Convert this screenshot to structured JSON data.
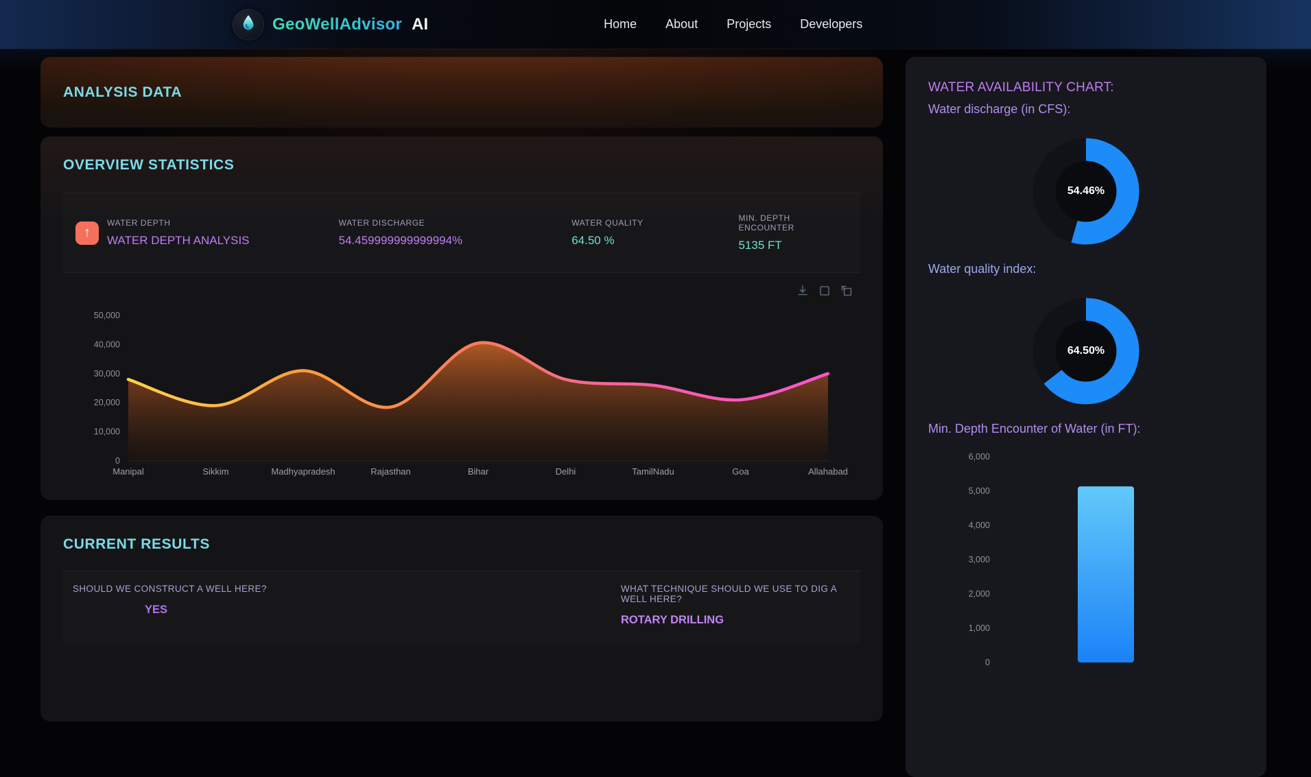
{
  "navbar": {
    "brand": "GeoWellAdvisor",
    "brand_suffix": "AI",
    "logo_icon": "water-drop-icon",
    "links": [
      {
        "label": "Home"
      },
      {
        "label": "About"
      },
      {
        "label": "Projects"
      },
      {
        "label": "Developers"
      }
    ]
  },
  "analysis": {
    "title": "ANALYSIS DATA"
  },
  "overview": {
    "title": "OVERVIEW STATISTICS",
    "icon_glyph": "↑",
    "icon_name": "trend-up-icon",
    "icon_bg": "#f4705a",
    "stats": [
      {
        "label": "WATER DEPTH",
        "value": "WATER DEPTH ANALYSIS",
        "color": "#c07df2"
      },
      {
        "label": "WATER DISCHARGE",
        "value": "54.459999999999994%",
        "color": "#c07df2"
      },
      {
        "label": "WATER QUALITY",
        "value": "64.50 %",
        "color": "#6fe0cf"
      },
      {
        "label": "MIN. DEPTH ENCOUNTER",
        "value": "5135 FT",
        "color": "#6fe0cf"
      }
    ],
    "toolbar_icons": [
      "download-icon",
      "selection-icon",
      "reset-zoom-icon"
    ]
  },
  "results": {
    "title": "CURRENT RESULTS",
    "qa": [
      {
        "question": "SHOULD WE CONSTRUCT A WELL HERE?",
        "answer": "YES"
      },
      {
        "question": "WHAT TECHNIQUE SHOULD WE USE TO DIG A WELL HERE?",
        "answer": "ROTARY DRILLING"
      }
    ]
  },
  "sidebar": {
    "title": "WATER AVAILABILITY CHART:",
    "discharge_label": "Water discharge (in CFS):",
    "quality_label": "Water quality index:",
    "depth_label": "Min. Depth Encounter of Water (in FT):"
  },
  "chart_data": [
    {
      "id": "water-depth-area",
      "type": "area",
      "title": "Water depth analysis by location",
      "categories": [
        "Manipal",
        "Sikkim",
        "Madhyapradesh",
        "Rajasthan",
        "Bihar",
        "Delhi",
        "TamilNadu",
        "Goa",
        "Allahabad"
      ],
      "values": [
        28000,
        19000,
        31000,
        18500,
        40500,
        28000,
        26000,
        21000,
        30000
      ],
      "xlabel": "",
      "ylabel": "",
      "ylim": [
        0,
        50000
      ],
      "ytick_step": 10000,
      "grid": false,
      "legend": "none",
      "line_gradient": [
        "#ffd24d",
        "#ff9e3d",
        "#fb7b5e",
        "#f55fa8",
        "#ff54d0"
      ],
      "fill_gradient_top": "rgba(190,95,38,0.92)",
      "fill_gradient_bottom": "rgba(35,18,10,0.40)"
    },
    {
      "id": "discharge-donut",
      "type": "donut",
      "title": "Water discharge (in CFS)",
      "value": 54.46,
      "label": "54.46%",
      "color": "#1d8bf8",
      "track": "#101217"
    },
    {
      "id": "quality-donut",
      "type": "donut",
      "title": "Water quality index",
      "value": 64.5,
      "label": "64.50%",
      "color": "#1d8bf8",
      "track": "#101217"
    },
    {
      "id": "min-depth-bar",
      "type": "bar",
      "title": "Min. depth encounter of water (in FT)",
      "categories": [
        ""
      ],
      "values": [
        5135
      ],
      "ylim": [
        0,
        6000
      ],
      "ytick_step": 1000,
      "grid": false,
      "bar_gradient": [
        "#62c9fb",
        "#1b82f7"
      ]
    }
  ]
}
